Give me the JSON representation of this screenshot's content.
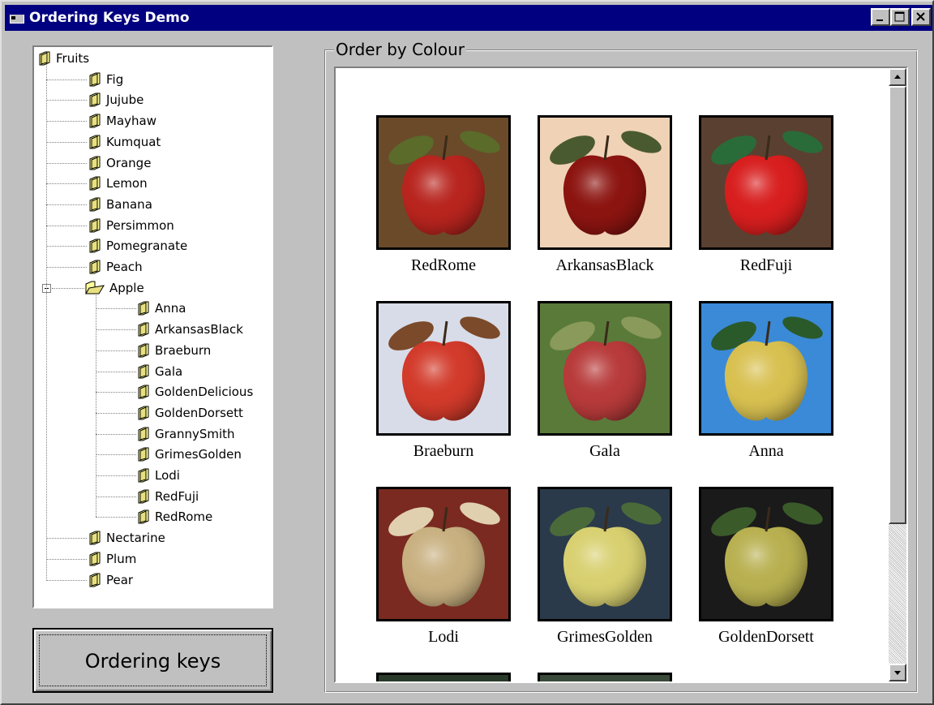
{
  "window": {
    "title": "Ordering Keys Demo",
    "icons": {
      "app": "app-window-icon",
      "minimize": "minimize-icon",
      "maximize": "maximize-icon",
      "close": "close-icon"
    }
  },
  "tree": {
    "root": "Fruits",
    "items": [
      "Fig",
      "Jujube",
      "Mayhaw",
      "Kumquat",
      "Orange",
      "Lemon",
      "Banana",
      "Persimmon",
      "Pomegranate",
      "Peach"
    ],
    "expanded_item": "Apple",
    "apple_children": [
      "Anna",
      "ArkansasBlack",
      "Braeburn",
      "Gala",
      "GoldenDelicious",
      "GoldenDorsett",
      "GrannySmith",
      "GrimesGolden",
      "Lodi",
      "RedFuji",
      "RedRome"
    ],
    "items_after": [
      "Nectarine",
      "Plum",
      "Pear"
    ],
    "folder_icon": "folder-icon",
    "open_folder_icon": "folder-open-icon"
  },
  "button": {
    "label": "Ordering keys"
  },
  "gallery": {
    "frame_label": "Order by Colour",
    "items": [
      {
        "name": "RedRome",
        "palette": [
          "#6b4a2a",
          "#b8241e",
          "#5a6b2a"
        ]
      },
      {
        "name": "ArkansasBlack",
        "palette": [
          "#f0d2b6",
          "#8c1410",
          "#4a5a30"
        ]
      },
      {
        "name": "RedFuji",
        "palette": [
          "#5a4030",
          "#d81e1e",
          "#2a6b3a"
        ]
      },
      {
        "name": "Braeburn",
        "palette": [
          "#d8dce8",
          "#d23a2a",
          "#7a4a2a"
        ]
      },
      {
        "name": "Gala",
        "palette": [
          "#5a7a3a",
          "#b83a3a",
          "#8a9a5a"
        ]
      },
      {
        "name": "Anna",
        "palette": [
          "#3a8ad8",
          "#d8c050",
          "#2a5a2a"
        ]
      },
      {
        "name": "Lodi",
        "palette": [
          "#7a2a20",
          "#c8b080",
          "#e0d0b0"
        ]
      },
      {
        "name": "GrimesGolden",
        "palette": [
          "#2a3a4a",
          "#d8d070",
          "#4a6a3a"
        ]
      },
      {
        "name": "GoldenDorsett",
        "palette": [
          "#1a1a1a",
          "#b8b050",
          "#3a5a2a"
        ]
      }
    ]
  }
}
